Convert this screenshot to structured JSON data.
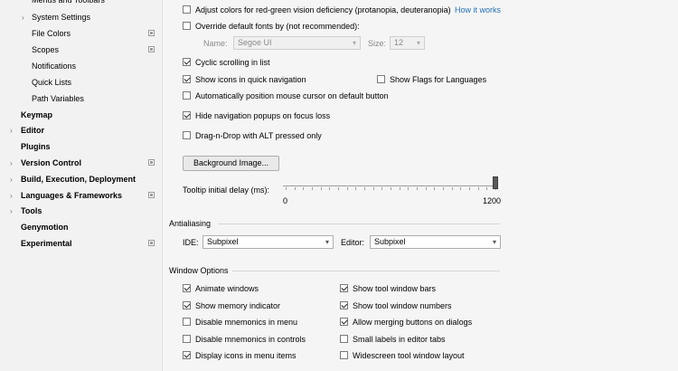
{
  "sidebar": {
    "items": [
      {
        "label": "Menus and Toolbars"
      },
      {
        "label": "System Settings"
      },
      {
        "label": "File Colors"
      },
      {
        "label": "Scopes"
      },
      {
        "label": "Notifications"
      },
      {
        "label": "Quick Lists"
      },
      {
        "label": "Path Variables"
      },
      {
        "label": "Keymap"
      },
      {
        "label": "Editor"
      },
      {
        "label": "Plugins"
      },
      {
        "label": "Version Control"
      },
      {
        "label": "Build, Execution, Deployment"
      },
      {
        "label": "Languages & Frameworks"
      },
      {
        "label": "Tools"
      },
      {
        "label": "Genymotion"
      },
      {
        "label": "Experimental"
      }
    ]
  },
  "appearance": {
    "adjust_colors": {
      "label": "Adjust colors for red-green vision deficiency (protanopia, deuteranopia)",
      "checked": false
    },
    "how_it_works": "How it works",
    "override_fonts": {
      "label": "Override default fonts by (not recommended):",
      "checked": false
    },
    "font_name_label": "Name:",
    "font_name_value": "Segoe UI",
    "font_size_label": "Size:",
    "font_size_value": "12",
    "cyclic_scrolling": {
      "label": "Cyclic scrolling in list",
      "checked": true
    },
    "show_icons_quick_nav": {
      "label": "Show icons in quick navigation",
      "checked": true
    },
    "show_flags_languages": {
      "label": "Show Flags for Languages",
      "checked": false
    },
    "auto_position_mouse": {
      "label": "Automatically position mouse cursor on default button",
      "checked": false
    },
    "hide_nav_popups": {
      "label": "Hide navigation popups on focus loss",
      "checked": true
    },
    "drag_n_drop_alt": {
      "label": "Drag-n-Drop with ALT pressed only",
      "checked": false
    },
    "background_image_button": "Background Image...",
    "tooltip_delay_label": "Tooltip initial delay (ms):",
    "tooltip_min": "0",
    "tooltip_max": "1200",
    "tooltip_value_fraction": 1.0
  },
  "antialiasing": {
    "title": "Antialiasing",
    "ide_label": "IDE:",
    "ide_value": "Subpixel",
    "editor_label": "Editor:",
    "editor_value": "Subpixel"
  },
  "window_options": {
    "title": "Window Options",
    "left": [
      {
        "label": "Animate windows",
        "checked": true
      },
      {
        "label": "Show memory indicator",
        "checked": true
      },
      {
        "label": "Disable mnemonics in menu",
        "checked": false
      },
      {
        "label": "Disable mnemonics in controls",
        "checked": false
      },
      {
        "label": "Display icons in menu items",
        "checked": true
      }
    ],
    "right": [
      {
        "label": "Show tool window bars",
        "checked": true
      },
      {
        "label": "Show tool window numbers",
        "checked": true
      },
      {
        "label": "Allow merging buttons on dialogs",
        "checked": true
      },
      {
        "label": "Small labels in editor tabs",
        "checked": false
      },
      {
        "label": "Widescreen tool window layout",
        "checked": false
      }
    ]
  },
  "colors": {
    "link": "#2470b3"
  }
}
